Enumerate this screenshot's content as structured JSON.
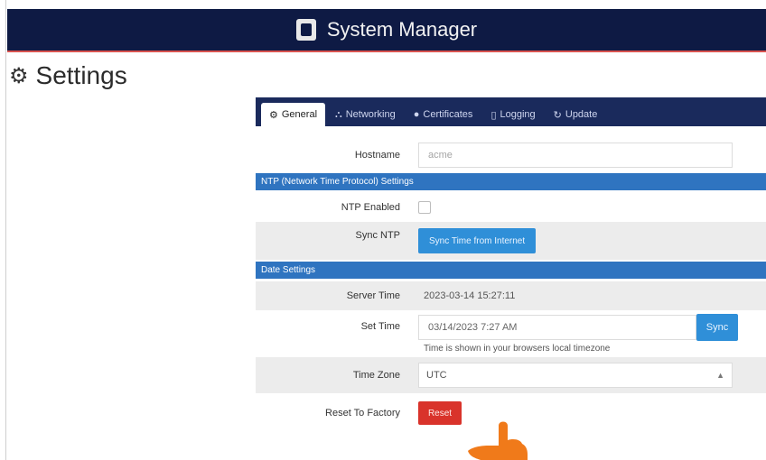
{
  "app": {
    "title": "System Manager",
    "icon": "server-icon"
  },
  "page": {
    "title": "Settings",
    "icon": "cogs-icon"
  },
  "tabs": [
    {
      "label": "General",
      "icon": "cogs-icon",
      "active": true
    },
    {
      "label": "Networking",
      "icon": "sitemap-icon",
      "active": false
    },
    {
      "label": "Certificates",
      "icon": "certificate-icon",
      "active": false
    },
    {
      "label": "Logging",
      "icon": "file-icon",
      "active": false
    },
    {
      "label": "Update",
      "icon": "refresh-icon",
      "active": false
    }
  ],
  "general": {
    "hostname_label": "Hostname",
    "hostname_placeholder": "acme"
  },
  "ntp": {
    "section_title": "NTP (Network Time Protocol) Settings",
    "enabled_label": "NTP Enabled",
    "enabled": false,
    "sync_label": "Sync NTP",
    "sync_button": "Sync Time from Internet"
  },
  "date": {
    "section_title": "Date Settings",
    "server_time_label": "Server Time",
    "server_time_value": "2023-03-14 15:27:11",
    "set_time_label": "Set Time",
    "set_time_value": "03/14/2023 7:27 AM",
    "sync_button": "Sync",
    "hint": "Time is shown in your browsers local timezone",
    "timezone_label": "Time Zone",
    "timezone_value": "UTC"
  },
  "reset": {
    "label": "Reset To Factory",
    "button": "Reset"
  },
  "colors": {
    "topbar": "#0e1a44",
    "tabbar": "#1a2a5c",
    "section": "#2f74c0",
    "button_blue": "#2f8fd8",
    "button_red": "#d9332b",
    "pointer": "#f07a1a"
  }
}
